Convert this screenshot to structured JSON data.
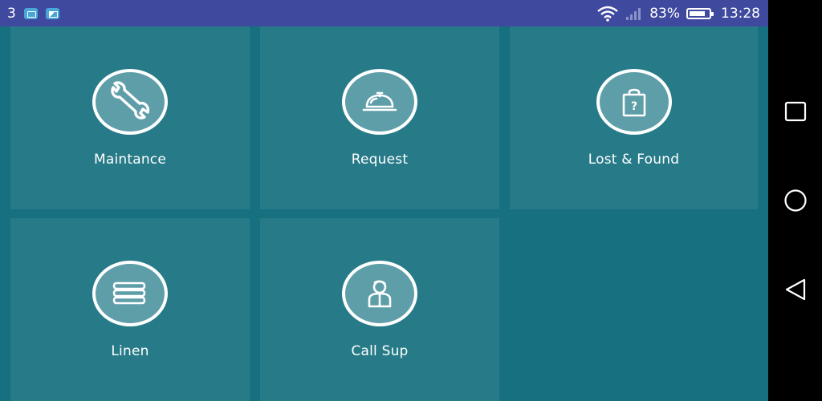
{
  "status_bar": {
    "notification_count": "3",
    "notif_icons": [
      "mail-app-icon",
      "gallery-app-icon"
    ],
    "signal_icons": [
      "wifi-icon",
      "cellular-signal-icon"
    ],
    "battery_percent_text": "83%",
    "battery_level": 0.83,
    "time": "13:28"
  },
  "tiles": [
    {
      "label": "Maintance",
      "icon": "wrench-icon"
    },
    {
      "label": "Request",
      "icon": "service-bell-icon"
    },
    {
      "label": "Lost & Found",
      "icon": "question-bag-icon"
    },
    {
      "label": "Linen",
      "icon": "linen-stack-icon"
    },
    {
      "label": "Call Sup",
      "icon": "supervisor-person-icon"
    }
  ],
  "navigation_bar": {
    "buttons": [
      "recents",
      "home",
      "back"
    ]
  },
  "colors": {
    "background": "#17707f",
    "tile": "#277b88",
    "status_bar": "#3f4a9f",
    "icon_circle": "#5e9ea8"
  }
}
